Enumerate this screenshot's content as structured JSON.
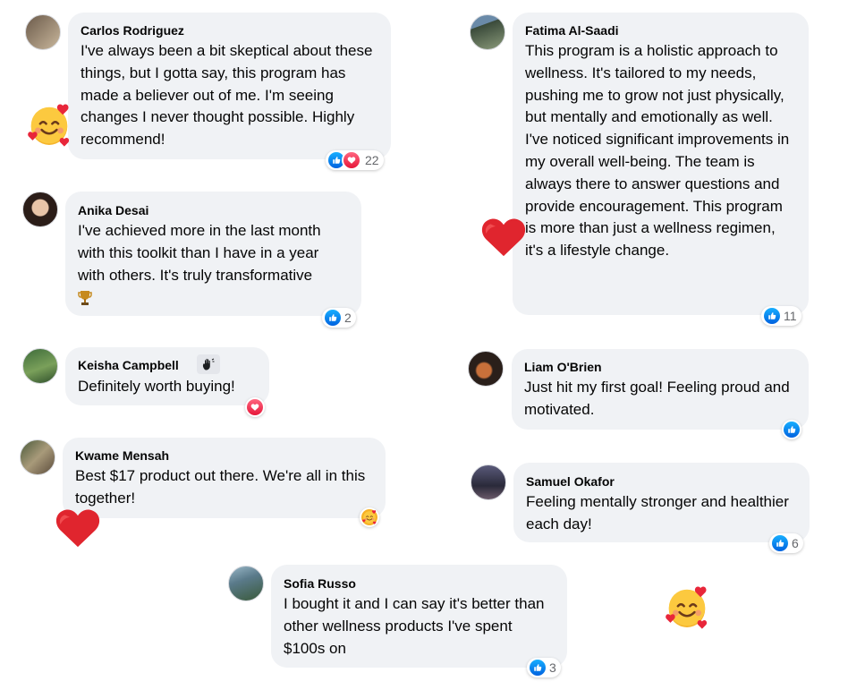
{
  "comments": [
    {
      "name": "Carlos Rodriguez",
      "text": "I've always been a bit skeptical about these things, but I gotta say, this program has made a believer out of me. I'm seeing changes I never thought possible. Highly recommend!",
      "reactions": [
        "like",
        "love"
      ],
      "count": "22",
      "avatar_colors": [
        "#6b5a4a",
        "#c9b79c"
      ]
    },
    {
      "name": "Anika Desai",
      "text": "I've achieved more in the last month with this toolkit than I have in a year with others. It's truly transformative",
      "trailing_icon": "trophy-icon",
      "reactions": [
        "like"
      ],
      "count": "2",
      "avatar_colors": [
        "#2b1d18",
        "#e8c4a8"
      ]
    },
    {
      "name": "Keisha Campbell",
      "text": "Definitely worth buying!",
      "badge_icon": "hand-wave-icon",
      "reactions": [
        "love"
      ],
      "count": "",
      "avatar_colors": [
        "#3d6b3a",
        "#7aa05a"
      ]
    },
    {
      "name": "Kwame Mensah",
      "text": "Best $17 product out there. We're all in this together!",
      "reactions": [
        "care"
      ],
      "count": "",
      "avatar_colors": [
        "#4a5a3a",
        "#a89a7a"
      ]
    },
    {
      "name": "Sofia Russo",
      "text": "I bought it and I can say it's better than other wellness products I've spent $100s on",
      "reactions": [
        "like"
      ],
      "count": "3",
      "avatar_colors": [
        "#5a7a8a",
        "#3a5a3a"
      ]
    },
    {
      "name": "Fatima Al-Saadi",
      "text": "This program is a holistic approach to wellness. It's tailored to my needs, pushing me to grow not just physically, but mentally and emotionally as well. I've noticed significant improvements in my overall well-being. The team is always there to answer questions and provide encouragement. This program is more than just a wellness regimen, it's a lifestyle change.",
      "reactions": [
        "like"
      ],
      "count": "11",
      "avatar_colors": [
        "#3a4a3a",
        "#8a9a7a"
      ]
    },
    {
      "name": "Liam O'Brien",
      "text": "Just hit my first goal! Feeling proud and motivated.",
      "reactions": [
        "like"
      ],
      "count": "",
      "avatar_colors": [
        "#2a1f1a",
        "#c8703a"
      ]
    },
    {
      "name": "Samuel Okafor",
      "text": "Feeling mentally stronger and healthier each day!",
      "reactions": [
        "like"
      ],
      "count": "6",
      "avatar_colors": [
        "#2a2a3a",
        "#6a5a6a"
      ]
    }
  ],
  "stickers": [
    "smiling-face-with-hearts-icon",
    "red-heart-icon",
    "red-heart-icon",
    "smiling-face-with-hearts-icon"
  ],
  "colors": {
    "bubble": "#f0f2f5",
    "like": "#1877f2",
    "love": "#f33e58",
    "care": "#f7b125",
    "count": "#65676b"
  }
}
